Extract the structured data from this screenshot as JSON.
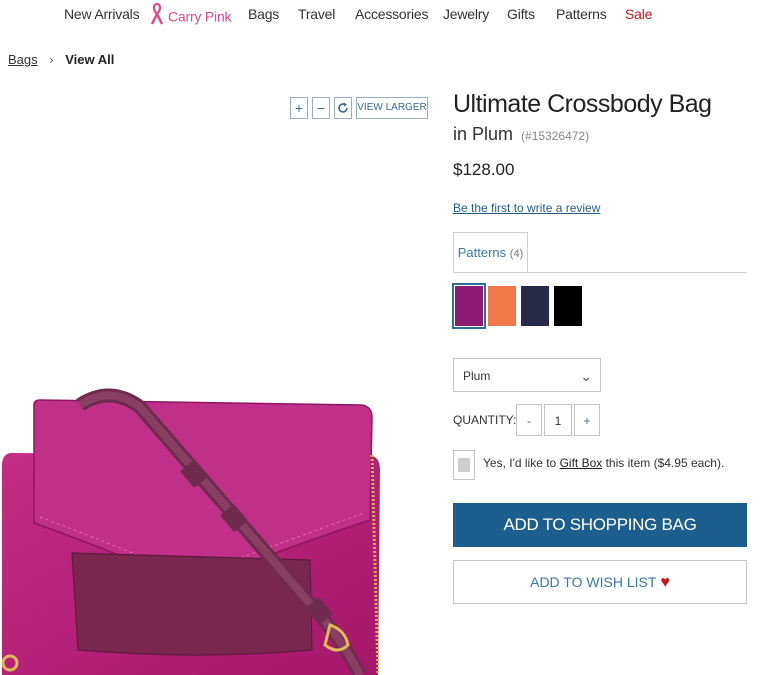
{
  "nav": {
    "items": [
      "New Arrivals",
      "Carry Pink",
      "Bags",
      "Travel",
      "Accessories",
      "Jewelry",
      "Gifts",
      "Patterns",
      "Sale"
    ],
    "ribbon_icon": "pink-ribbon-icon",
    "pink_color": "#e2478d",
    "sale_color": "#c5161d"
  },
  "breadcrumb": {
    "link": "Bags",
    "current": "View All",
    "separator_icon": "chevron-right-icon"
  },
  "image_tools": {
    "zoom_in": "+",
    "zoom_out": "−",
    "rotate_icon": "rotate-icon",
    "view_larger": "VIEW LARGER"
  },
  "product": {
    "title": "Ultimate Crossbody Bag",
    "color_line": "in Plum",
    "sku": "(#15326472)",
    "price": "$128.00",
    "review_link": "Be the first to write a review"
  },
  "patterns": {
    "tab_label": "Patterns",
    "tab_count": "(4)",
    "swatches": [
      {
        "name": "Plum",
        "color": "#8b1a74",
        "selected": true
      },
      {
        "name": "Coral",
        "color": "#f2784b",
        "selected": false
      },
      {
        "name": "Navy",
        "color": "#262a48",
        "selected": false
      },
      {
        "name": "Black",
        "color": "#000000",
        "selected": false
      }
    ]
  },
  "select": {
    "value": "Plum"
  },
  "quantity": {
    "label": "QUANTITY:",
    "minus": "-",
    "value": "1",
    "plus": "+"
  },
  "gift": {
    "prefix": "Yes, I'd like to ",
    "link": "Gift Box",
    "suffix": " this item ($4.95 each)."
  },
  "actions": {
    "add_to_bag": "ADD TO SHOPPING BAG",
    "wish_list": "ADD TO WISH LIST",
    "heart_icon": "heart-icon",
    "accent": "#1c5f8e"
  }
}
